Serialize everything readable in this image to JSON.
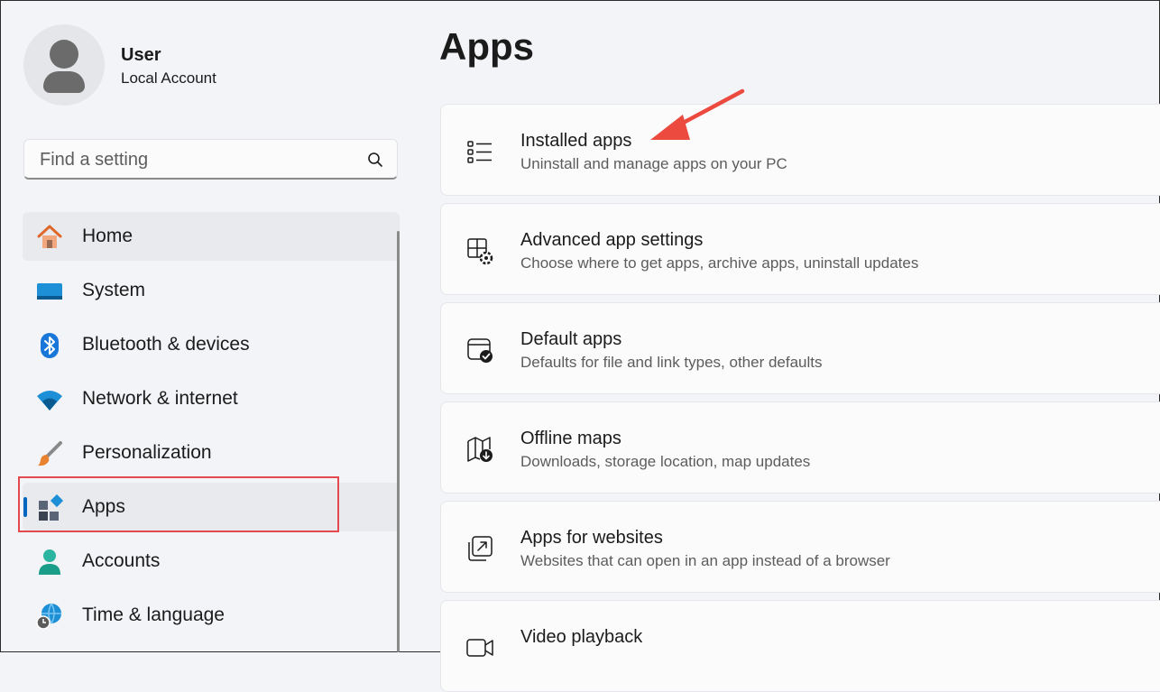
{
  "profile": {
    "name": "User",
    "account_type": "Local Account"
  },
  "search": {
    "placeholder": "Find a setting"
  },
  "nav": {
    "items": [
      {
        "label": "Home"
      },
      {
        "label": "System"
      },
      {
        "label": "Bluetooth & devices"
      },
      {
        "label": "Network & internet"
      },
      {
        "label": "Personalization"
      },
      {
        "label": "Apps",
        "selected": true
      },
      {
        "label": "Accounts"
      },
      {
        "label": "Time & language"
      }
    ]
  },
  "main": {
    "title": "Apps",
    "cards": [
      {
        "title": "Installed apps",
        "subtitle": "Uninstall and manage apps on your PC",
        "icon": "list-icon"
      },
      {
        "title": "Advanced app settings",
        "subtitle": "Choose where to get apps, archive apps, uninstall updates",
        "icon": "app-settings-icon"
      },
      {
        "title": "Default apps",
        "subtitle": "Defaults for file and link types, other defaults",
        "icon": "default-apps-icon"
      },
      {
        "title": "Offline maps",
        "subtitle": "Downloads, storage location, map updates",
        "icon": "map-download-icon"
      },
      {
        "title": "Apps for websites",
        "subtitle": "Websites that can open in an app instead of a browser",
        "icon": "open-in-app-icon"
      },
      {
        "title": "Video playback",
        "subtitle": "",
        "icon": "video-icon"
      }
    ]
  },
  "colors": {
    "accent": "#0067c0",
    "annotation": "#e5484d",
    "background": "#f3f4f8"
  }
}
